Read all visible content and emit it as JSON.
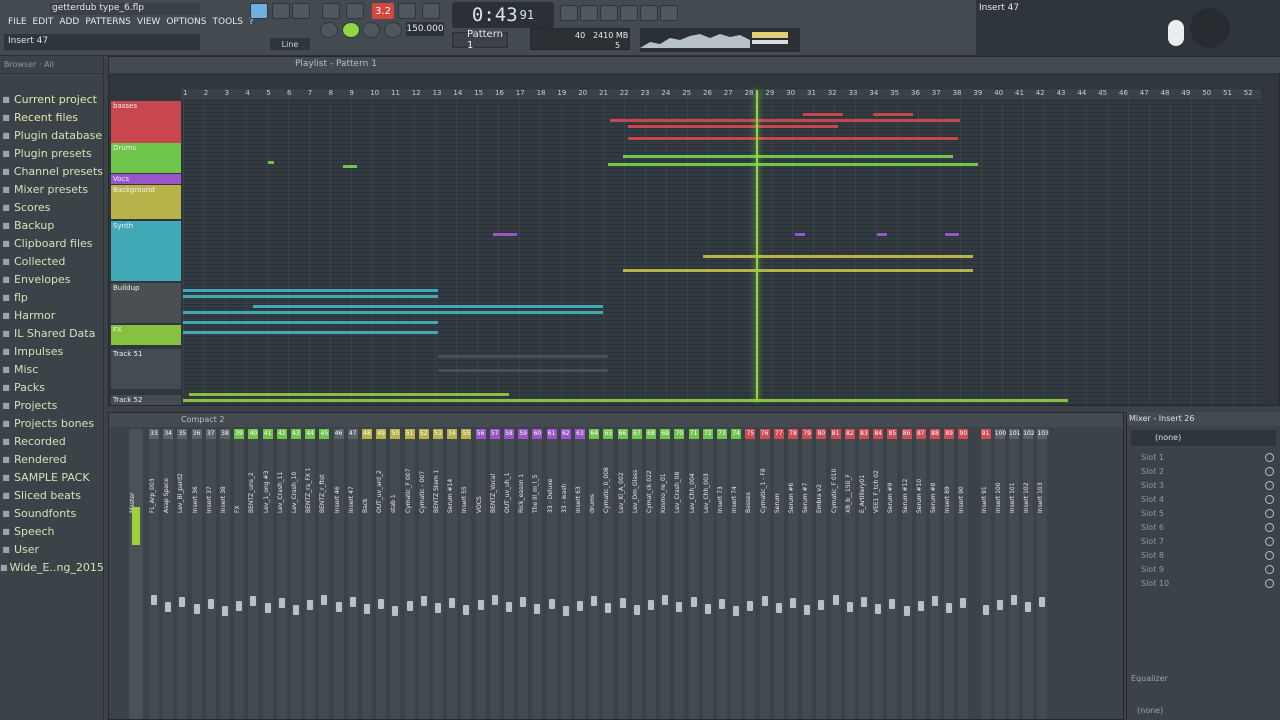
{
  "window": {
    "file_title": "getterdub type_6.flp",
    "hint": "Insert 47",
    "hint_right": "Insert 47"
  },
  "menu": [
    "FILE",
    "EDIT",
    "ADD",
    "PATTERNS",
    "VIEW",
    "OPTIONS",
    "TOOLS",
    "?"
  ],
  "transport": {
    "time": "0:43",
    "time_small": "91",
    "tempo": "150.000",
    "pattern": "Pattern 1",
    "snap": "Line",
    "rec": "3.2"
  },
  "cpu": {
    "value": "40",
    "mem": "2410 MB",
    "poly": "5"
  },
  "browser": {
    "header": "Browser · All",
    "items": [
      "Current project",
      "Recent files",
      "Plugin database",
      "Plugin presets",
      "Channel presets",
      "Mixer presets",
      "Scores",
      "Backup",
      "Clipboard files",
      "Collected",
      "Envelopes",
      "flp",
      "Harmor",
      "IL Shared Data",
      "Impulses",
      "Misc",
      "Packs",
      "Projects",
      "Projects bones",
      "Recorded",
      "Rendered",
      "SAMPLE PACK",
      "Sliced beats",
      "Soundfonts",
      "Speech",
      "User",
      "Wide_E..ng_2015"
    ]
  },
  "playlist": {
    "title": "Playlist - Pattern 1",
    "tracks": [
      {
        "name": "basses",
        "color": "#c8474f"
      },
      {
        "name": "Drums",
        "color": "#6fc64a"
      },
      {
        "name": "Vocs",
        "color": "#9b54c9"
      },
      {
        "name": "Background",
        "color": "#b8b24a"
      },
      {
        "name": "Synth",
        "color": "#41a9b5"
      },
      {
        "name": "Buildup",
        "color": "#4a4f53"
      },
      {
        "name": "FX",
        "color": "#86c23f"
      },
      {
        "name": "Track 51",
        "color": "#454c51"
      },
      {
        "name": "Track 52",
        "color": "#454c51"
      }
    ],
    "bars": [
      "1",
      "2",
      "3",
      "4",
      "5",
      "6",
      "7",
      "8",
      "9",
      "10",
      "11",
      "12",
      "13",
      "14",
      "15",
      "16",
      "17",
      "18",
      "19",
      "20",
      "21",
      "22",
      "23",
      "24",
      "25",
      "26",
      "27",
      "28",
      "29",
      "30",
      "31",
      "32",
      "33",
      "34",
      "35",
      "36",
      "37",
      "38",
      "39",
      "40",
      "41",
      "42",
      "43",
      "44",
      "45",
      "46",
      "47",
      "48",
      "49",
      "50",
      "51",
      "52"
    ]
  },
  "mixer": {
    "title": "Compact 2",
    "master": "Master",
    "channels": [
      {
        "num": "33",
        "label": "FL_Arp_003"
      },
      {
        "num": "34",
        "label": "Asap Space"
      },
      {
        "num": "35",
        "label": "Lev_Bl_pard2"
      },
      {
        "num": "36",
        "label": "Insert 36"
      },
      {
        "num": "37",
        "label": "Insert 37"
      },
      {
        "num": "38",
        "label": "Insert 38"
      },
      {
        "num": "39",
        "label": "FX"
      },
      {
        "num": "40",
        "label": "BENTZ_uns_2"
      },
      {
        "num": "41",
        "label": "Lev_1_ong #3"
      },
      {
        "num": "42",
        "label": "Lev_Crash_11"
      },
      {
        "num": "43",
        "label": "Lev_Crash_10"
      },
      {
        "num": "44",
        "label": "BENTZ_ra_FX 1"
      },
      {
        "num": "45",
        "label": "BENTZ_r_ftst"
      },
      {
        "num": "46",
        "label": "Insert 46"
      },
      {
        "num": "47",
        "label": "Insert 47"
      },
      {
        "num": "48",
        "label": "Back"
      },
      {
        "num": "49",
        "label": "OUT_uv_ard_2"
      },
      {
        "num": "50",
        "label": "stab 1"
      },
      {
        "num": "51",
        "label": "Cymatic_F 007"
      },
      {
        "num": "52",
        "label": "Cymatic - 007"
      },
      {
        "num": "53",
        "label": "BENTZ Stem 1"
      },
      {
        "num": "54",
        "label": "Serum #14"
      },
      {
        "num": "55",
        "label": "Insert 55"
      },
      {
        "num": "56",
        "label": "VOCS"
      },
      {
        "num": "57",
        "label": "BENTZ_Vocal"
      },
      {
        "num": "58",
        "label": "OUT_uv_uh_1"
      },
      {
        "num": "59",
        "label": "Rick_eason 1"
      },
      {
        "num": "60",
        "label": "The lil_m_l_5"
      },
      {
        "num": "61",
        "label": "33 - Deluxe"
      },
      {
        "num": "62",
        "label": "33 - wash"
      },
      {
        "num": "63",
        "label": "Insert 63"
      },
      {
        "num": "64",
        "label": "drums"
      },
      {
        "num": "65",
        "label": "Cymatic_0_008"
      },
      {
        "num": "66",
        "label": "Lev_Kl_A_002"
      },
      {
        "num": "67",
        "label": "Lev_Dm_Glass"
      },
      {
        "num": "68",
        "label": "Cymat_ck 022"
      },
      {
        "num": "69",
        "label": "Kosmo_re_01"
      },
      {
        "num": "70",
        "label": "Lev_Crash_08"
      },
      {
        "num": "71",
        "label": "Lev_Chh_004"
      },
      {
        "num": "72",
        "label": "Lev_Chh_003"
      },
      {
        "num": "73",
        "label": "Insert 73"
      },
      {
        "num": "74",
        "label": "Insert 74"
      },
      {
        "num": "75",
        "label": "Basses"
      },
      {
        "num": "76",
        "label": "Cymatic_1 - F8"
      },
      {
        "num": "77",
        "label": "Serum"
      },
      {
        "num": "78",
        "label": "Serum #6"
      },
      {
        "num": "79",
        "label": "Serum #7"
      },
      {
        "num": "80",
        "label": "Embra v2"
      },
      {
        "num": "81",
        "label": "Cymatic_F 010"
      },
      {
        "num": "82",
        "label": "XB_b__150_F"
      },
      {
        "num": "83",
        "label": "E_Artillery01"
      },
      {
        "num": "84",
        "label": "VEE1 F_tch 02"
      },
      {
        "num": "85",
        "label": "Serum #9"
      },
      {
        "num": "86",
        "label": "Serum #12"
      },
      {
        "num": "87",
        "label": "Serum #10"
      },
      {
        "num": "88",
        "label": "Serum #8"
      },
      {
        "num": "89",
        "label": "Insert 89"
      },
      {
        "num": "90",
        "label": "Insert 90"
      },
      {
        "num": "91",
        "label": "Insert 91"
      },
      {
        "num": "100",
        "label": "Insert 100"
      },
      {
        "num": "101",
        "label": "Insert 101"
      },
      {
        "num": "102",
        "label": "Insert 102"
      },
      {
        "num": "103",
        "label": "Insert 103"
      }
    ]
  },
  "insert": {
    "title": "Mixer - Insert 26",
    "preset": "(none)",
    "slots": [
      "Slot 1",
      "Slot 2",
      "Slot 3",
      "Slot 4",
      "Slot 5",
      "Slot 6",
      "Slot 7",
      "Slot 8",
      "Slot 9",
      "Slot 10"
    ],
    "eq": "Equalizer",
    "none2": "(none)"
  },
  "colors": {
    "accent": "#8ed642",
    "bg": "#3b4349"
  }
}
